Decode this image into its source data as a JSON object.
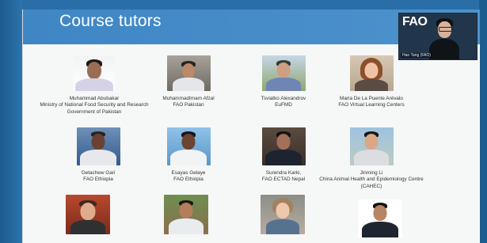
{
  "slide": {
    "title": "Course tutors"
  },
  "tutors": [
    {
      "name": "Muhammad Abubakar",
      "org": [
        "Ministry of National Food Security and Research",
        "Government of Pakistan"
      ]
    },
    {
      "name": "MuhammadImam Afzal",
      "org": [
        "FAO Pakistan"
      ]
    },
    {
      "name": "Tsviatko Alexandrov",
      "org": [
        "EuFMD"
      ]
    },
    {
      "name": "Maria De La Puente Arévalo",
      "org": [
        "FAO Virtual Learning Centers"
      ]
    },
    {
      "name": "Getachew Gari",
      "org": [
        "FAO Ethiopia"
      ]
    },
    {
      "name": "Esayas Gelaye",
      "org": [
        "FAO Ethiopia"
      ]
    },
    {
      "name": "Surendra Karki,",
      "org": [
        "FAO ECTAD Nepal"
      ]
    },
    {
      "name": "Jinming Li",
      "org": [
        "China Animal Health and Epidemiology Centre",
        "(CAHEC)"
      ]
    },
    {
      "name": "",
      "org": []
    },
    {
      "name": "",
      "org": []
    },
    {
      "name": "",
      "org": []
    },
    {
      "name": "",
      "org": []
    }
  ],
  "video": {
    "logo": "FAO",
    "participant_name": "Hao Tang (FAO)"
  },
  "colors": {
    "header": "#4a8fcb",
    "background": "#1f5f93",
    "slide": "#f6f7f7"
  }
}
